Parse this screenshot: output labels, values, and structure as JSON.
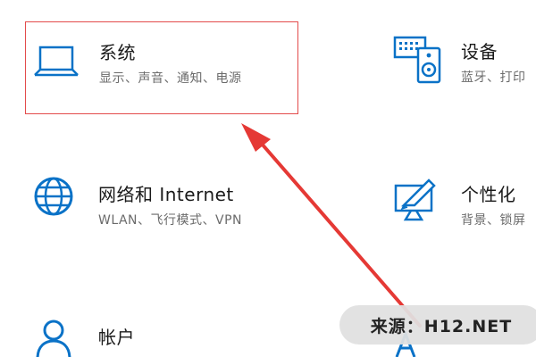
{
  "accent_color": "#0a72c7",
  "highlight_color": "#e34b4b",
  "tiles": {
    "system": {
      "title": "系统",
      "desc": "显示、声音、通知、电源",
      "icon": "laptop-icon"
    },
    "devices": {
      "title": "设备",
      "desc": "蓝牙、打印",
      "icon": "devices-icon"
    },
    "network": {
      "title": "网络和 Internet",
      "desc": "WLAN、飞行模式、VPN",
      "icon": "globe-icon"
    },
    "personal": {
      "title": "个性化",
      "desc": "背景、锁屏",
      "icon": "personalization-icon"
    },
    "accounts": {
      "title": "帐户",
      "desc": "",
      "icon": "person-icon"
    },
    "time": {
      "title": "",
      "desc": "",
      "icon": "time-language-icon"
    }
  },
  "watermark": {
    "text": "来源：H12.NET"
  }
}
